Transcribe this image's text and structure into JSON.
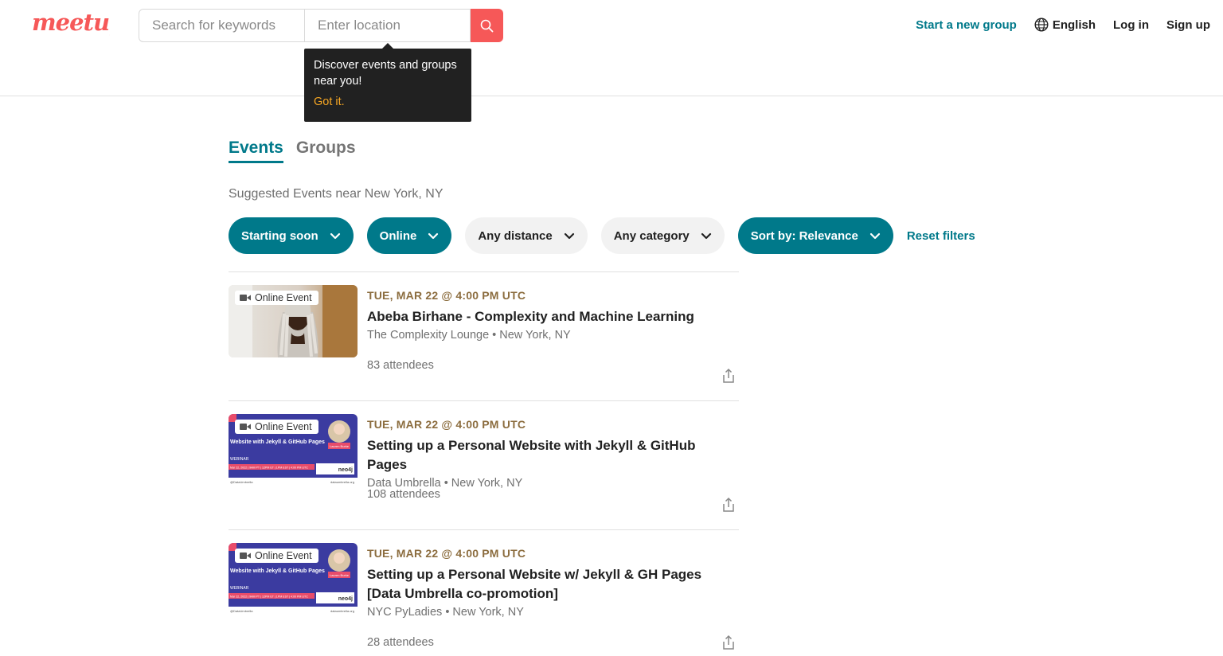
{
  "header": {
    "logo_text": "Meetup",
    "search": {
      "keywords_placeholder": "Search for keywords",
      "location_placeholder": "Enter location"
    },
    "tooltip": {
      "text": "Discover events and groups near you!",
      "action": "Got it."
    },
    "nav": {
      "start_group": "Start a new group",
      "language": "English",
      "login": "Log in",
      "signup": "Sign up"
    }
  },
  "tabs": [
    {
      "label": "Events",
      "active": true
    },
    {
      "label": "Groups",
      "active": false
    }
  ],
  "suggested_heading": "Suggested Events near New York, NY",
  "filters": {
    "starting_soon": "Starting soon",
    "online": "Online",
    "distance": "Any distance",
    "category": "Any category",
    "sort": "Sort by: Relevance",
    "reset": "Reset filters"
  },
  "events": [
    {
      "badge": "Online Event",
      "date": "TUE, MAR 22 @ 4:00 PM UTC",
      "title": "Abeba Birhane - Complexity and Machine Learning",
      "group": "The Complexity Lounge • New York, NY",
      "attendees": "83 attendees"
    },
    {
      "badge": "Online Event",
      "date": "TUE, MAR 22 @ 4:00 PM UTC",
      "title": "Setting up a Personal Website with Jekyll & GitHub Pages",
      "group": "Data Umbrella • New York, NY",
      "attendees": "108 attendees"
    },
    {
      "badge": "Online Event",
      "date": "TUE, MAR 22 @ 4:00 PM UTC",
      "title": "Setting up a Personal Website w/ Jekyll & GH Pages [Data Umbrella co-promotion]",
      "group": "NYC PyLadies • New York, NY",
      "attendees": "28 attendees"
    }
  ],
  "webinar_thumb": {
    "heading": "Website with Jekyll & GitHub Pages",
    "tag": "WEBINAR",
    "dates": "Mar 22, 2022 | 9AM PT | 12PM ET | 1PM EST | 4:00 PM UTC",
    "speaker": "Lauren Burke",
    "footer_left": "@DataUmbrella",
    "footer_right": "dataumbrella.org",
    "sponsor": "neo4j"
  },
  "colors": {
    "brand": "#f65858",
    "teal": "#00798a",
    "date": "#8c6d3f",
    "tooltip_bg": "#212121",
    "tooltip_action": "#f5a623"
  }
}
